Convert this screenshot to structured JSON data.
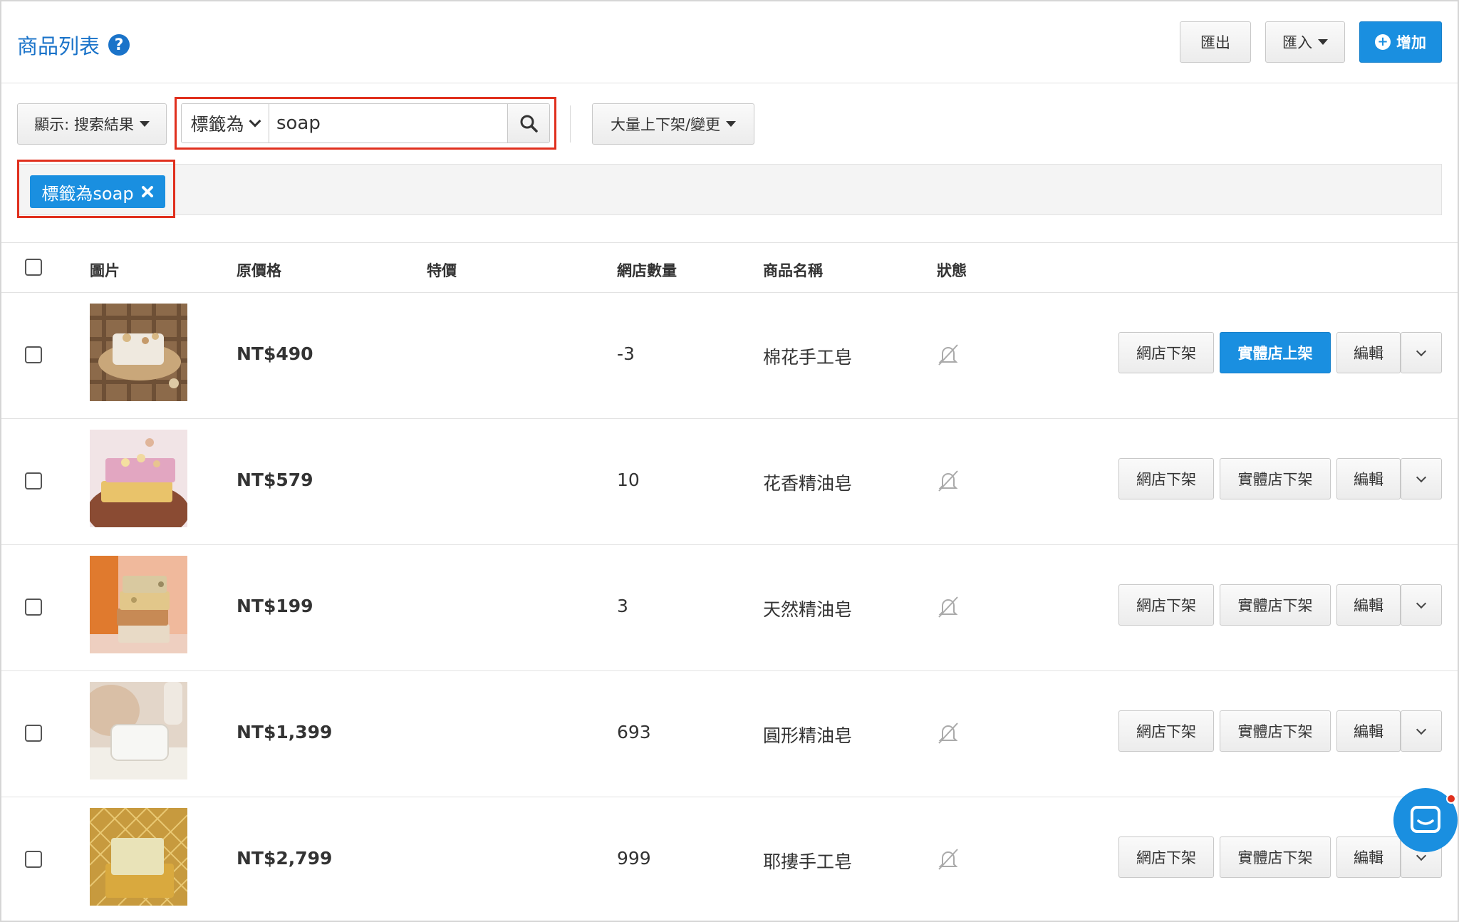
{
  "header": {
    "title": "商品列表",
    "export_label": "匯出",
    "import_label": "匯入",
    "add_label": "增加"
  },
  "filters": {
    "display_label": "顯示: 搜索結果",
    "field_label": "標籤為",
    "search_value": "soap",
    "bulk_label": "大量上下架/變更",
    "active_tag": "標籤為soap"
  },
  "table": {
    "headers": {
      "image": "圖片",
      "original_price": "原價格",
      "special_price": "特價",
      "online_qty": "網店數量",
      "name": "商品名稱",
      "status": "狀態"
    },
    "rows": [
      {
        "price": "NT$490",
        "qty": "-3",
        "name": "棉花手工皂",
        "online_btn": "網店下架",
        "store_btn": "實體店上架",
        "store_active": true,
        "edit_btn": "編輯",
        "image": "soap-on-wooden-tray"
      },
      {
        "price": "NT$579",
        "qty": "10",
        "name": "花香精油皂",
        "online_btn": "網店下架",
        "store_btn": "實體店下架",
        "store_active": false,
        "edit_btn": "編輯",
        "image": "pink-and-yellow-soap-stack"
      },
      {
        "price": "NT$199",
        "qty": "3",
        "name": "天然精油皂",
        "online_btn": "網店下架",
        "store_btn": "實體店下架",
        "store_active": false,
        "edit_btn": "編輯",
        "image": "soap-stack-orange-background"
      },
      {
        "price": "NT$1,399",
        "qty": "693",
        "name": "圓形精油皂",
        "online_btn": "網店下架",
        "store_btn": "實體店下架",
        "store_active": false,
        "edit_btn": "編輯",
        "image": "white-soap-on-towel"
      },
      {
        "price": "NT$2,799",
        "qty": "999",
        "name": "耶摟手工皂",
        "online_btn": "網店下架",
        "store_btn": "實體店下架",
        "store_active": false,
        "edit_btn": "編輯",
        "image": "yellow-soap-on-net"
      }
    ]
  },
  "colors": {
    "accent": "#1a8fe0",
    "highlight": "#e0301e",
    "title": "#1a73c9"
  },
  "icons": {
    "help": "question-circle-icon",
    "status": "bell-slash-icon",
    "search": "search-icon",
    "chat": "chat-icon"
  }
}
